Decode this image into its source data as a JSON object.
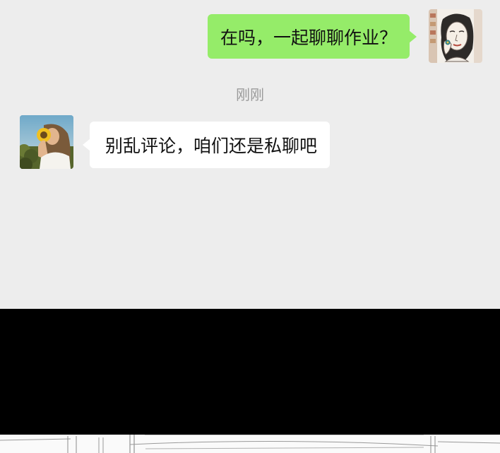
{
  "messages": [
    {
      "id": "sent-1",
      "direction": "outgoing",
      "text": "在吗，一起聊聊作业？"
    },
    {
      "id": "received-1",
      "direction": "incoming",
      "text": "别乱评论，咱们还是私聊吧"
    }
  ],
  "timestamp": "刚刚",
  "colors": {
    "background": "#ededed",
    "outgoing_bubble": "#95ec69",
    "incoming_bubble": "#ffffff"
  },
  "icons": {
    "my_avatar": "sketch-portrait-avatar",
    "contact_avatar": "sunflower-photo-avatar"
  }
}
